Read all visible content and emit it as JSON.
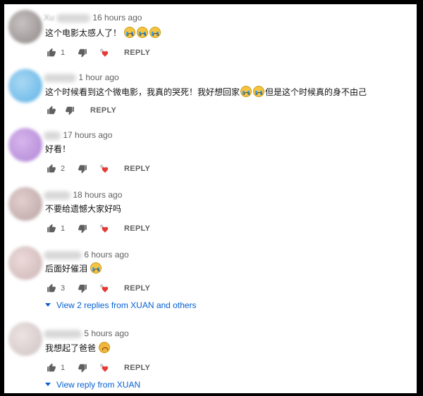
{
  "comments": [
    {
      "name_blur": "Xu",
      "time": "16 hours ago",
      "text": "这个电影太感人了！",
      "emoji_count": 3,
      "likes": "1",
      "reply_label": "REPLY"
    },
    {
      "time": "1 hour ago",
      "text_a": "这个时候看到这个微电影，我真的哭死！我好想回家",
      "text_b": "但是这个时候真的身不由己",
      "reply_label": "REPLY"
    },
    {
      "time": "17 hours ago",
      "text": "好看！",
      "likes": "2",
      "reply_label": "REPLY"
    },
    {
      "time": "18 hours ago",
      "text": "不要给遗憾大家好吗",
      "likes": "1",
      "reply_label": "REPLY"
    },
    {
      "time": "6 hours ago",
      "text": "后面好催泪",
      "likes": "3",
      "reply_label": "REPLY",
      "view_replies": "View 2 replies from XUAN and others"
    },
    {
      "time": "5 hours ago",
      "text": "我想起了爸爸",
      "likes": "1",
      "reply_label": "REPLY",
      "view_replies": "View reply from XUAN"
    }
  ],
  "colors": {
    "link": "#065fd4",
    "heart": "#e53935",
    "muted": "#606060"
  },
  "icons": [
    "thumb-up-icon",
    "thumb-down-icon",
    "creator-heart-icon",
    "crying-emoji-icon",
    "sad-emoji-icon"
  ]
}
